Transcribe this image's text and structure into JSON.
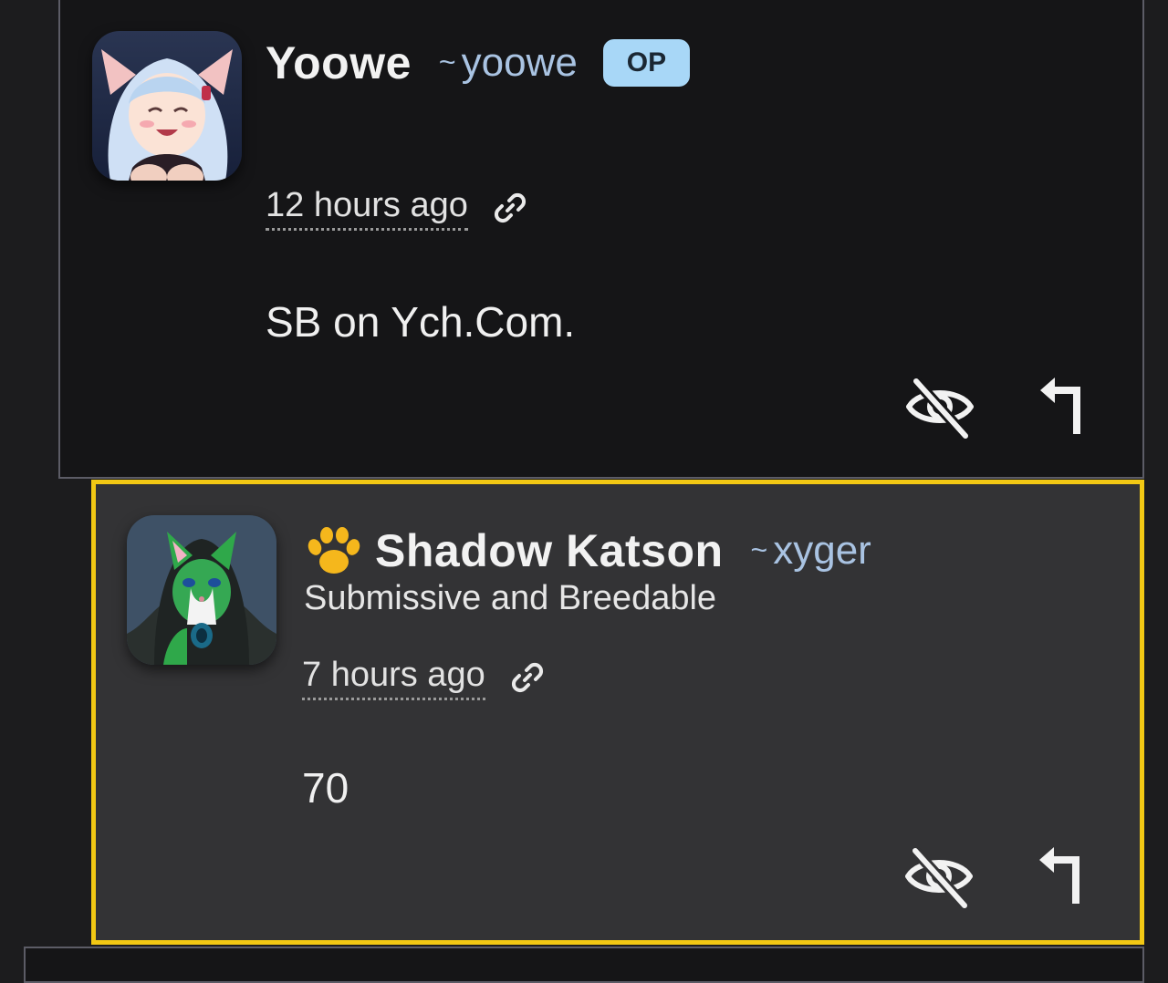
{
  "comments": [
    {
      "display_name": "Yoowe",
      "handle_prefix": "~",
      "handle": "yoowe",
      "badge": "OP",
      "timestamp": "12 hours ago",
      "body": "SB on Ych.Com.",
      "icons": {
        "avatar": "anime-catgirl-avatar",
        "link": "link-icon",
        "hide": "eye-slash-icon",
        "reply": "reply-arrow-icon"
      }
    },
    {
      "display_name": "Shadow Katson",
      "handle_prefix": "~",
      "handle": "xyger",
      "subtitle": "Submissive and Breedable",
      "timestamp": "7 hours ago",
      "body": "70",
      "icons": {
        "avatar": "green-cat-avatar",
        "flair": "paw-icon",
        "link": "link-icon",
        "hide": "eye-slash-icon",
        "reply": "reply-arrow-icon"
      }
    }
  ],
  "colors": {
    "page_bg": "#1c1c1e",
    "comment_bg": "#151517",
    "highlight_bg": "#333335",
    "highlight_border": "#f2c814",
    "handle": "#a9c3e2",
    "op_badge_bg": "#a8d7f7"
  }
}
